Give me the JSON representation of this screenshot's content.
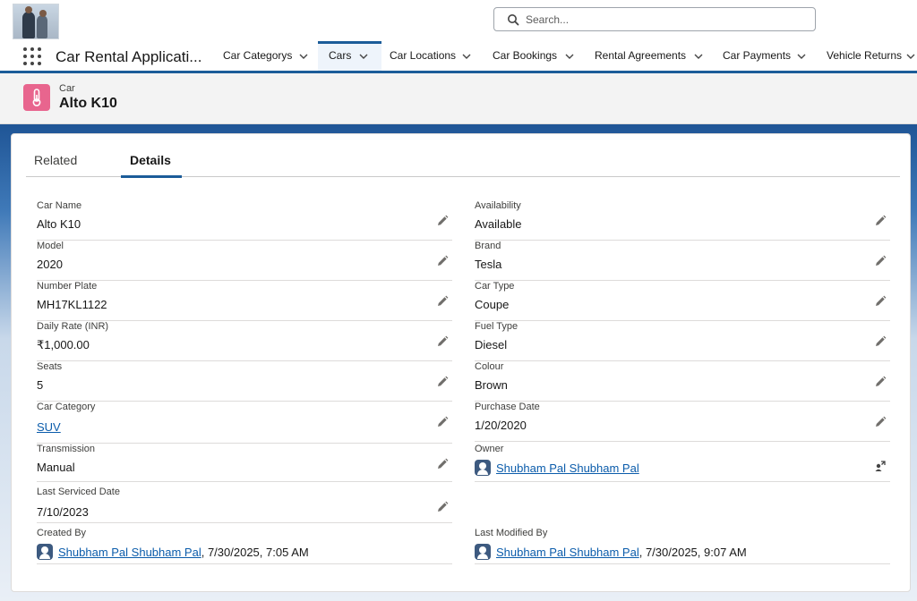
{
  "app": {
    "name": "Car Rental Applicati..."
  },
  "search": {
    "placeholder": "Search..."
  },
  "nav": {
    "tabs": [
      {
        "label": "Car Categorys"
      },
      {
        "label": "Cars"
      },
      {
        "label": "Car Locations"
      },
      {
        "label": "Car Bookings"
      },
      {
        "label": "Rental Agreements"
      },
      {
        "label": "Car Payments"
      },
      {
        "label": "Vehicle Returns"
      }
    ]
  },
  "record": {
    "object_label": "Car",
    "name": "Alto K10"
  },
  "detail_tabs": {
    "related": "Related",
    "details": "Details"
  },
  "fields": {
    "car_name": {
      "label": "Car Name",
      "value": "Alto K10"
    },
    "model": {
      "label": "Model",
      "value": "2020"
    },
    "number_plate": {
      "label": "Number Plate",
      "value": "MH17KL1122"
    },
    "daily_rate": {
      "label": "Daily Rate (INR)",
      "value": "₹1,000.00"
    },
    "seats": {
      "label": "Seats",
      "value": "5"
    },
    "car_category": {
      "label": "Car Category",
      "value": "SUV"
    },
    "transmission": {
      "label": "Transmission",
      "value": "Manual"
    },
    "last_serviced_date": {
      "label": "Last Serviced Date",
      "value": "7/10/2023"
    },
    "created_by": {
      "label": "Created By",
      "user": "Shubham Pal Shubham Pal",
      "timestamp": ", 7/30/2025, 7:05 AM"
    },
    "availability": {
      "label": "Availability",
      "value": "Available"
    },
    "brand": {
      "label": "Brand",
      "value": "Tesla"
    },
    "car_type": {
      "label": "Car Type",
      "value": "Coupe"
    },
    "fuel_type": {
      "label": "Fuel Type",
      "value": "Diesel"
    },
    "colour": {
      "label": "Colour",
      "value": "Brown"
    },
    "purchase_date": {
      "label": "Purchase Date",
      "value": "1/20/2020"
    },
    "owner": {
      "label": "Owner",
      "user": "Shubham Pal Shubham Pal"
    },
    "last_modified_by": {
      "label": "Last Modified By",
      "user": "Shubham Pal Shubham Pal",
      "timestamp": ", 7/30/2025, 9:07 AM"
    }
  },
  "colors": {
    "brand_blue": "#1b5c99",
    "link": "#0b5cab",
    "object_icon": "#e8658e",
    "header_bg": "#f3f3f3"
  },
  "icons": [
    "app-logo",
    "search-icon",
    "app-launcher-icon",
    "chevron-down-icon",
    "car-object-icon",
    "edit-pencil-icon",
    "user-avatar-icon",
    "change-owner-icon"
  ]
}
